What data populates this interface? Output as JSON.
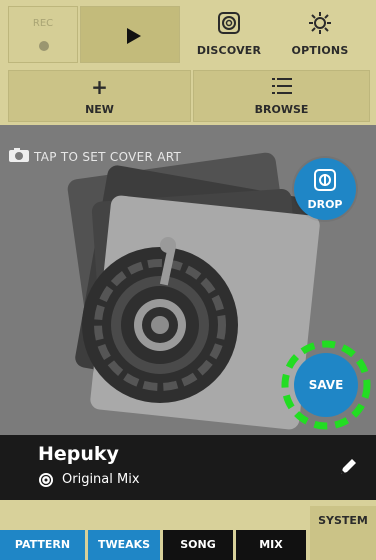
{
  "transport": {
    "rec_label": "REC",
    "discover_label": "DISCOVER",
    "options_label": "OPTIONS"
  },
  "actions": {
    "new_label": "NEW",
    "browse_label": "BROWSE"
  },
  "cover": {
    "hint": "TAP TO SET COVER ART",
    "drop_label": "DROP",
    "save_label": "SAVE"
  },
  "track": {
    "title": "Hepuky",
    "mix": "Original Mix"
  },
  "tabs": {
    "pattern": "PATTERN",
    "tweaks": "TWEAKS",
    "song": "SONG",
    "mix": "MIX",
    "system": "SYSTEM"
  },
  "colors": {
    "accent_blue": "#1f86c6",
    "panel_khaki": "#d8d19a",
    "highlight_green": "#22dd22"
  },
  "icons": [
    "camera-icon",
    "drop-icon",
    "vinyl-icon",
    "pencil-icon",
    "discover-icon",
    "gear-icon",
    "list-icon",
    "plus-icon",
    "play-icon"
  ]
}
